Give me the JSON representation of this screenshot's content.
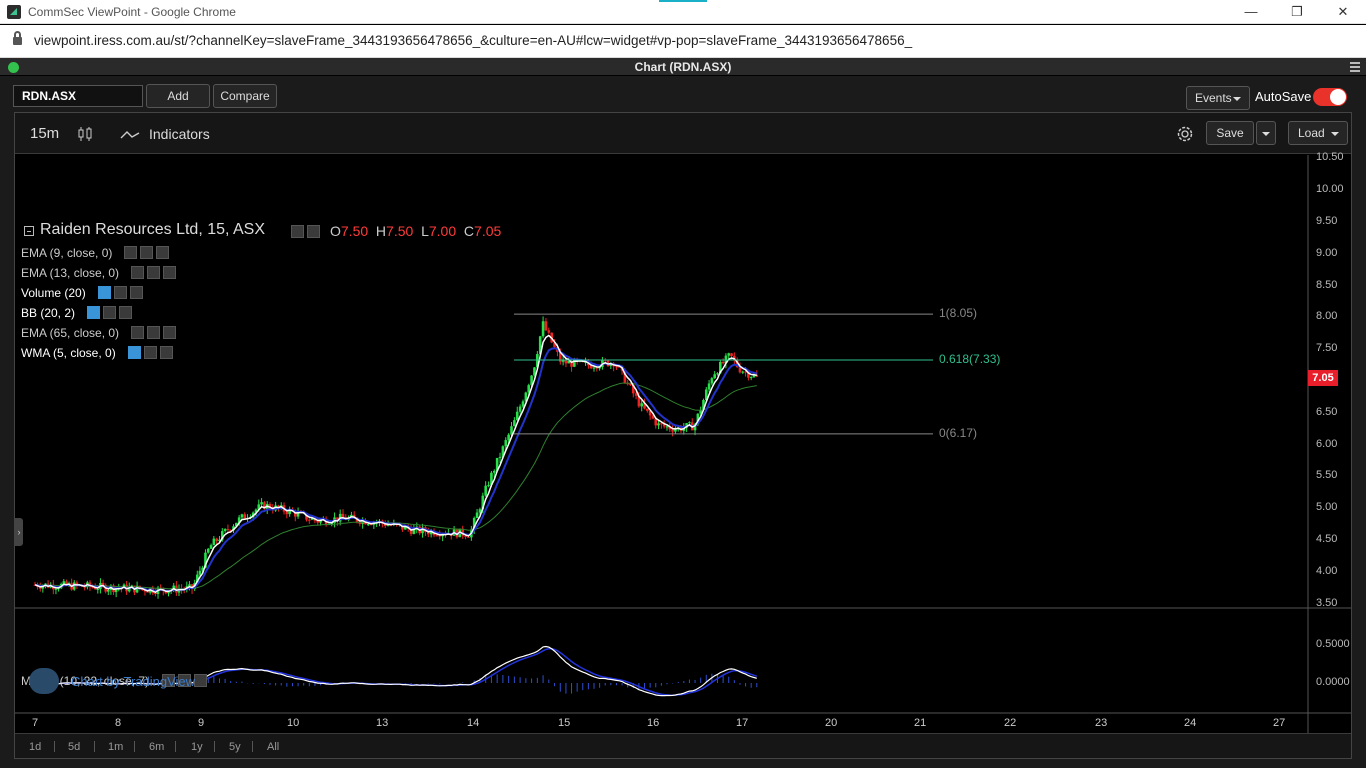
{
  "browser": {
    "window_title": "CommSec ViewPoint - Google Chrome",
    "url": "viewpoint.iress.com.au/st/?channelKey=slaveFrame_3443193656478656_&culture=en-AU#lcw=widget#vp-pop=slaveFrame_3443193656478656_",
    "controls": {
      "minimize": "—",
      "restore": "❐",
      "close": "✕"
    }
  },
  "app": {
    "title": "Chart (RDN.ASX)",
    "symbol": "RDN.ASX",
    "add_label": "Add",
    "compare_label": "Compare",
    "events_label": "Events",
    "autosave_label": "AutoSave",
    "autosave_on": true,
    "accent_color": "#e8322a"
  },
  "toolbar": {
    "interval": "15m",
    "indicators_label": "Indicators",
    "save_label": "Save",
    "load_label": "Load"
  },
  "legend": {
    "title": "Raiden Resources Ltd, 15, ASX",
    "ohlc": [
      {
        "k": "O",
        "v": "7.50"
      },
      {
        "k": "H",
        "v": "7.50"
      },
      {
        "k": "L",
        "v": "7.00"
      },
      {
        "k": "C",
        "v": "7.05"
      }
    ],
    "studies": [
      {
        "label": "EMA (9, close, 0)",
        "visible": false
      },
      {
        "label": "EMA (13, close, 0)",
        "visible": false
      },
      {
        "label": "Volume (20)",
        "visible": true
      },
      {
        "label": "BB (20, 2)",
        "visible": true
      },
      {
        "label": "EMA (65, close, 0)",
        "visible": false
      },
      {
        "label": "WMA (5, close, 0)",
        "visible": true
      }
    ],
    "macd_label": "MACD (10, 22, close, 7)"
  },
  "watermark": "Chart by TradingView",
  "ranges": [
    "1d",
    "5d",
    "1m",
    "6m",
    "1y",
    "5y",
    "All"
  ],
  "chart_data": {
    "type": "candlestick",
    "price_axis": {
      "ticks": [
        "10.50",
        "10.00",
        "9.50",
        "9.00",
        "8.50",
        "8.00",
        "7.50",
        "7.00",
        "6.50",
        "6.00",
        "5.50",
        "5.00",
        "4.50",
        "4.00",
        "3.50"
      ],
      "range": [
        3.45,
        10.55
      ],
      "last_price": "7.05",
      "last_price_color": "#e81e2b"
    },
    "macd_axis": {
      "ticks": [
        "0.5000",
        "0.0000"
      ]
    },
    "x_axis_labels": [
      "7",
      "8",
      "9",
      "10",
      "13",
      "14",
      "15",
      "16",
      "17",
      "20",
      "21",
      "22",
      "23",
      "24",
      "27"
    ],
    "fibonacci": [
      {
        "label": "1(8.05)",
        "value": 8.05,
        "color": "#888888"
      },
      {
        "label": "0.618(7.33)",
        "value": 7.33,
        "color": "#2fbf8f"
      },
      {
        "label": "0(6.17)",
        "value": 6.17,
        "color": "#888888"
      }
    ],
    "close_path": [
      [
        0,
        3.8
      ],
      [
        0.5,
        3.78
      ],
      [
        1,
        3.75
      ],
      [
        1.5,
        3.72
      ],
      [
        1.9,
        3.74
      ],
      [
        2.1,
        4.4
      ],
      [
        2.4,
        4.8
      ],
      [
        2.7,
        5.05
      ],
      [
        3.0,
        4.95
      ],
      [
        3.3,
        4.8
      ],
      [
        3.6,
        4.85
      ],
      [
        4.0,
        4.78
      ],
      [
        4.4,
        4.65
      ],
      [
        4.8,
        4.62
      ],
      [
        5.0,
        4.6
      ],
      [
        5.2,
        5.4
      ],
      [
        5.5,
        6.4
      ],
      [
        5.7,
        7.2
      ],
      [
        5.8,
        7.9
      ],
      [
        6.0,
        7.3
      ],
      [
        6.3,
        7.25
      ],
      [
        6.6,
        7.3
      ],
      [
        6.9,
        6.6
      ],
      [
        7.1,
        6.3
      ],
      [
        7.3,
        6.25
      ],
      [
        7.5,
        6.3
      ],
      [
        7.7,
        7.1
      ],
      [
        7.9,
        7.4
      ],
      [
        8.0,
        7.2
      ],
      [
        8.2,
        7.05
      ]
    ],
    "series": [
      {
        "name": "WMA (5, close, 0)",
        "color": "#ffffff"
      },
      {
        "name": "BB (20, 2)",
        "color": "#2233cc"
      },
      {
        "name": "EMA (65, close, 0)",
        "color": "#2f7f2f"
      }
    ],
    "up_color": "#26e04a",
    "down_color": "#ee2222"
  }
}
